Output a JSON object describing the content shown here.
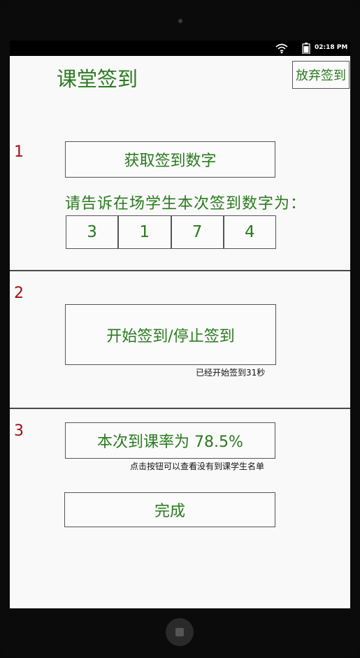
{
  "status": {
    "time": "02:18 PM",
    "wifi_icon": "wifi-icon",
    "battery_icon": "battery-icon"
  },
  "header": {
    "title": "课堂签到",
    "abandon_label": "放弃签到"
  },
  "section1": {
    "number": "1",
    "get_code_label": "获取签到数字",
    "prompt": "请告诉在场学生本次签到数字为：",
    "digits": [
      "3",
      "1",
      "7",
      "4"
    ]
  },
  "section2": {
    "number": "2",
    "toggle_label": "开始签到/停止签到",
    "elapsed_text": "已经开始签到31秒"
  },
  "section3": {
    "number": "3",
    "rate_label": "本次到课率为 78.5%",
    "rate_hint": "点击按钮可以查看没有到课学生名单",
    "finish_label": "完成"
  },
  "colors": {
    "accent_green": "#2a7a1f",
    "number_red": "#a01010",
    "border": "#555555"
  }
}
